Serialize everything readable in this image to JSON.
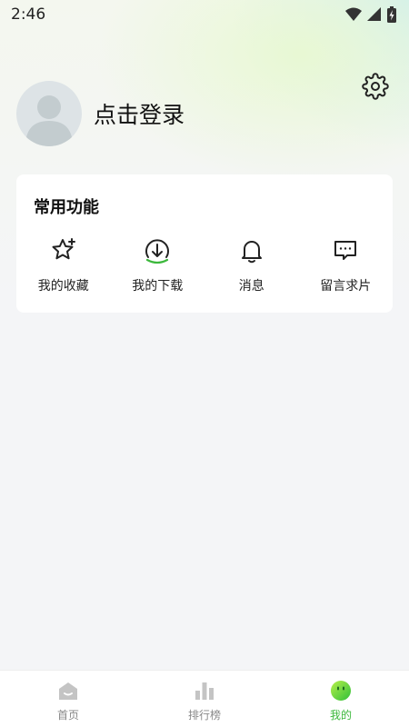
{
  "status_bar": {
    "time": "2:46"
  },
  "profile": {
    "login_text": "点击登录"
  },
  "common": {
    "title": "常用功能",
    "items": [
      {
        "label": "我的收藏",
        "icon": "star-icon"
      },
      {
        "label": "我的下载",
        "icon": "download-icon"
      },
      {
        "label": "消息",
        "icon": "bell-icon"
      },
      {
        "label": "留言求片",
        "icon": "message-icon"
      }
    ]
  },
  "nav": {
    "items": [
      {
        "label": "首页",
        "icon": "home-icon"
      },
      {
        "label": "排行榜",
        "icon": "chart-icon"
      },
      {
        "label": "我的",
        "icon": "mine-face-icon",
        "active": true
      }
    ]
  },
  "colors": {
    "accent": "#3cb83c",
    "nav_inactive": "#c4c4c4"
  }
}
